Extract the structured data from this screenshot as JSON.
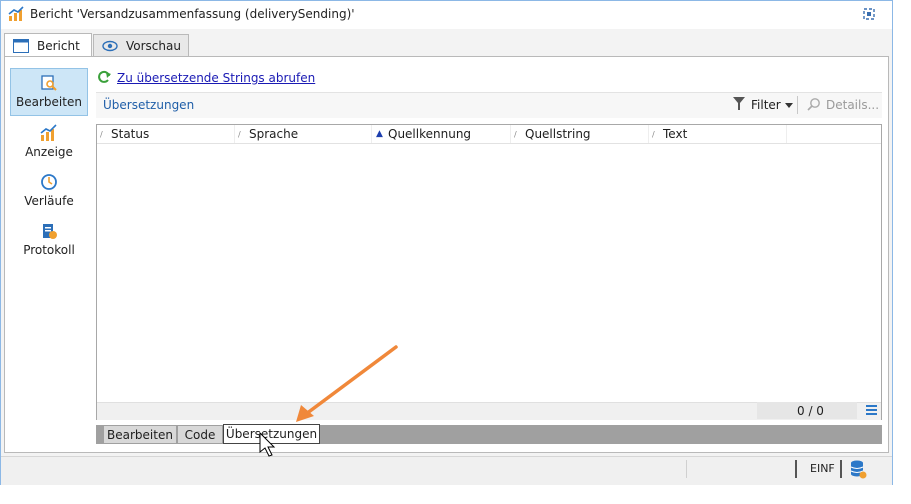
{
  "window": {
    "title": "Bericht 'Versandzusammenfassung (deliverySending)'"
  },
  "tabs": [
    {
      "label": "Bericht",
      "icon": "window-icon",
      "active": true
    },
    {
      "label": "Vorschau",
      "icon": "eye-icon",
      "active": false
    }
  ],
  "nav": [
    {
      "label": "Bearbeiten",
      "icon": "edit-magnifier-icon",
      "active": true
    },
    {
      "label": "Anzeige",
      "icon": "chart-icon",
      "active": false
    },
    {
      "label": "Verläufe",
      "icon": "clock-icon",
      "active": false
    },
    {
      "label": "Protokoll",
      "icon": "log-icon",
      "active": false
    }
  ],
  "toolbar": {
    "fetch_link": "Zu übersetzende Strings abrufen",
    "section_label": "Übersetzungen",
    "filter_label": "Filter",
    "details_label": "Details..."
  },
  "grid": {
    "columns": [
      "Status",
      "Sprache",
      "Quellkennung",
      "Quellstring",
      "Text"
    ],
    "sorted_column": "Quellkennung",
    "count": "0 / 0"
  },
  "bottom_tabs": [
    {
      "label": "Bearbeiten",
      "active": false
    },
    {
      "label": "Code",
      "active": false
    },
    {
      "label": "Übersetzungen",
      "active": true
    }
  ],
  "statusbar": {
    "mode": "EINF"
  },
  "colors": {
    "accent": "#f0883a",
    "link": "#1a1ab4",
    "nav_active": "#cde6f7"
  }
}
